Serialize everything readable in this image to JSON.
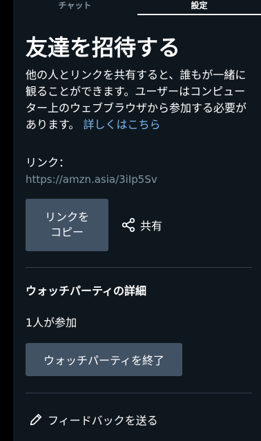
{
  "tabs": {
    "chat_label": "チャット",
    "settings_label": "設定",
    "active": "settings"
  },
  "invite": {
    "title": "友達を招待する",
    "description": "他の人とリンクを共有すると、誰もが一緒に観ることができます。ユーザーはコンピューター上のウェブブラウザから参加する必要があります。",
    "learn_more": "詳しくはこちら",
    "link_label": "リンク：",
    "link_url": "https://amzn.asia/3iIp5Sv",
    "copy_button": "リンクを\nコピー",
    "share_button": "共有",
    "share_icon": "share-icon"
  },
  "details": {
    "title": "ウォッチパーティの詳細",
    "participants": "1人が参加",
    "end_button": "ウォッチパーティを終了"
  },
  "feedback": {
    "label": "フィードバックを送る",
    "icon": "pencil-icon"
  },
  "colors": {
    "panel_bg": "#0f171e",
    "button_bg": "#425265",
    "link": "#79b8f3",
    "muted": "#8197a4",
    "divider": "#33404d"
  }
}
